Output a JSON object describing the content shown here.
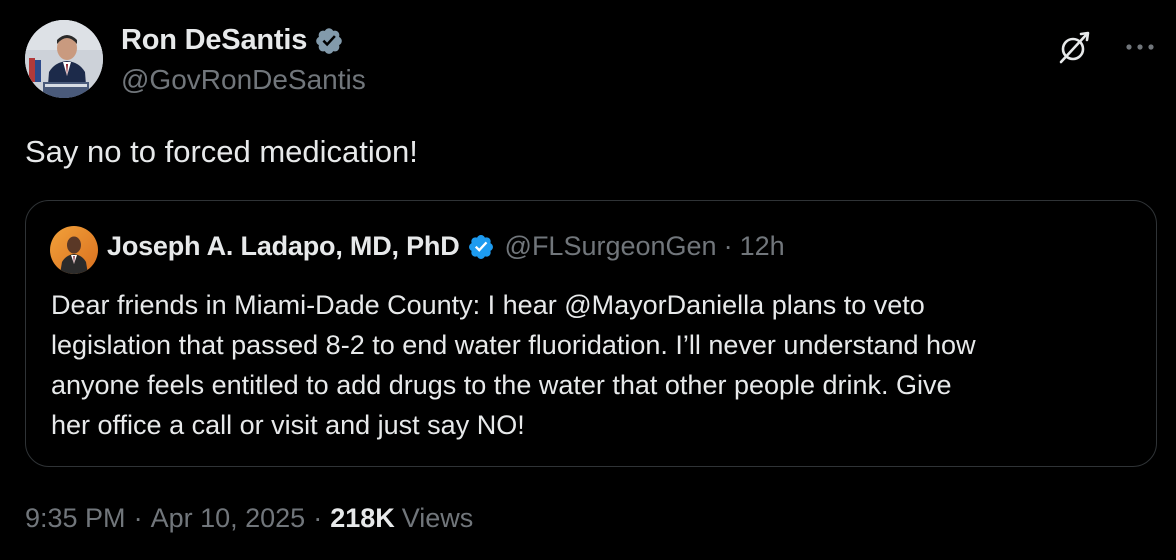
{
  "tweet": {
    "author": {
      "name": "Ron DeSantis",
      "handle": "@GovRonDeSantis",
      "verified": true,
      "avatar": "avatar-photo"
    },
    "text": "Say no to forced medication!",
    "actions": {
      "grok_icon": "grok-icon",
      "more_icon": "more-icon"
    },
    "quoted": {
      "author": {
        "name": "Joseph A. Ladapo, MD, PhD",
        "handle": "@FLSurgeonGen",
        "verified": true,
        "avatar": "avatar-photo"
      },
      "separator": "·",
      "time": "12h",
      "text": "Dear friends in Miami-Dade County: I hear @MayorDaniella plans to veto\nlegislation that passed 8-2 to end water fluoridation. I’ll never understand how\nanyone feels entitled to add drugs to the water that other people drink. Give\nher office a call or visit and just say NO!"
    },
    "meta": {
      "time": "9:35 PM",
      "separator": "·",
      "date": "Apr 10, 2025",
      "views_count": "218K",
      "views_label": "Views"
    }
  },
  "colors": {
    "background": "#000000",
    "text_primary": "#e7e9ea",
    "text_secondary": "#71767b",
    "verified_blue": "#1d9bf0",
    "verified_gray": "#829aab",
    "border": "#2f3336"
  }
}
